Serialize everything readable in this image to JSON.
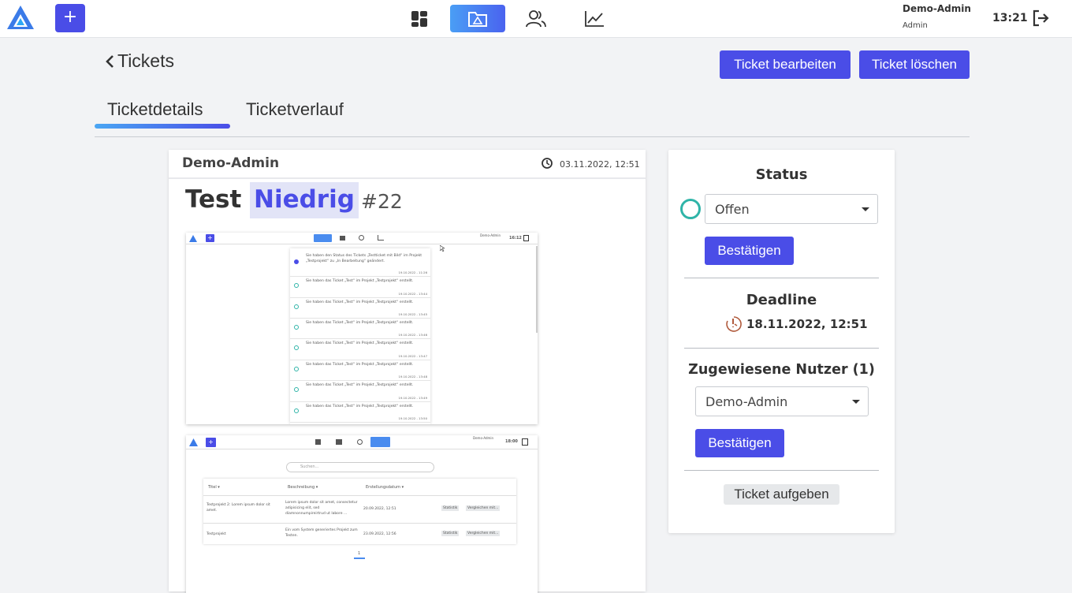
{
  "header": {
    "user_name": "Demo-Admin",
    "user_role": "Admin",
    "time": "13:21",
    "add_label": "+",
    "nav": [
      "dashboard-icon",
      "projects-icon",
      "users-icon",
      "statistics-icon"
    ],
    "active_nav": "projects-icon"
  },
  "page": {
    "back_label": "Tickets",
    "edit_button": "Ticket bearbeiten",
    "delete_button": "Ticket löschen",
    "tabs": [
      {
        "label": "Ticketdetails",
        "active": true
      },
      {
        "label": "Ticketverlauf",
        "active": false
      }
    ]
  },
  "ticket": {
    "author": "Demo-Admin",
    "created": "03.11.2022, 12:51",
    "title": "Test",
    "priority": "Niedrig",
    "number": "#22"
  },
  "attachment1": {
    "user": "Demo-Admin",
    "time": "16:12",
    "notifications": [
      {
        "text": "Sie haben den Status des Tickets „Testticket mit Bild“ im Projekt „Testprojekt“ zu „In Bearbeitung“ geändert.",
        "date": "19.10.2022 - 11:26"
      },
      {
        "text": "Sie haben das Ticket „Test“ im Projekt „Testprojekt“ erstellt.",
        "date": "19.10.2022 - 13:44"
      },
      {
        "text": "Sie haben das Ticket „Test“ im Projekt „Testprojekt“ erstellt.",
        "date": "19.10.2022 - 13:45"
      },
      {
        "text": "Sie haben das Ticket „Test“ im Projekt „Testprojekt“ erstellt.",
        "date": "19.10.2022 - 13:46"
      },
      {
        "text": "Sie haben das Ticket „Test“ im Projekt „Testprojekt“ erstellt.",
        "date": "19.10.2022 - 13:47"
      },
      {
        "text": "Sie haben das Ticket „Test“ im Projekt „Testprojekt“ erstellt.",
        "date": "19.10.2022 - 13:48"
      },
      {
        "text": "Sie haben das Ticket „Test“ im Projekt „Testprojekt“ erstellt.",
        "date": "19.10.2022 - 13:49"
      },
      {
        "text": "Sie haben das Ticket „Test“ im Projekt „Testprojekt“ erstellt.",
        "date": "19.10.2022 - 13:50"
      }
    ]
  },
  "attachment2": {
    "user": "Demo-Admin",
    "time": "18:00",
    "search_placeholder": "Suchen...",
    "columns": [
      "Titel ▾",
      "Beschreibung ▾",
      "Erstellungsdatum ▾"
    ],
    "rows": [
      {
        "title": "Testprojekt 2: Lorem ipsum dolor sit amet.",
        "desc": "Lorem ipsum dolor sit amet, consectetur adipisicing elit, sed diamnonnumpireirtrud ut labore ...",
        "date": "20.09.2022, 12:51"
      },
      {
        "title": "Testprojekt",
        "desc": "Ein vom System generiertes Projekt zum Testen.",
        "date": "23.09.2022, 12:56"
      }
    ],
    "row_buttons": [
      "Statistik",
      "Vergleichen mit..."
    ],
    "page": "1"
  },
  "sidebar": {
    "status_heading": "Status",
    "status_value": "Offen",
    "confirm_label": "Bestätigen",
    "deadline_heading": "Deadline",
    "deadline_value": "18.11.2022, 12:51",
    "assigned_heading": "Zugewiesene Nutzer (1)",
    "assigned_value": "Demo-Admin",
    "giveup_label": "Ticket aufgeben"
  },
  "colors": {
    "accent": "#4a4de7",
    "status_open": "#2fb4a8",
    "deadline_icon": "#b05a3c"
  }
}
